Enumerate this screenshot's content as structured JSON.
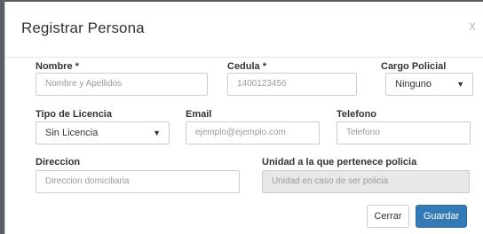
{
  "modal": {
    "title": "Registrar Persona",
    "close_label": "x"
  },
  "form": {
    "nombre": {
      "label": "Nombre *",
      "placeholder": "Nombre y Apellidos"
    },
    "cedula": {
      "label": "Cedula *",
      "placeholder": "1400123456"
    },
    "cargo": {
      "label": "Cargo Policial",
      "selected": "Ninguno"
    },
    "licencia": {
      "label": "Tipo de Licencia",
      "selected": "Sin Licencia"
    },
    "email": {
      "label": "Email",
      "placeholder": "ejemplo@ejemplo.com"
    },
    "telefono": {
      "label": "Telefono",
      "placeholder": "Telefono"
    },
    "direccion": {
      "label": "Direccion",
      "placeholder": "Direccion domiciliaria"
    },
    "unidad": {
      "label": "Unidad a la que pertenece policia",
      "placeholder": "Unidad en caso de ser policia"
    }
  },
  "footer": {
    "cancel_label": "Cerrar",
    "save_label": "Guardar"
  },
  "colors": {
    "primary": "#337ab7",
    "disabled_bg": "#e8e8e8"
  }
}
